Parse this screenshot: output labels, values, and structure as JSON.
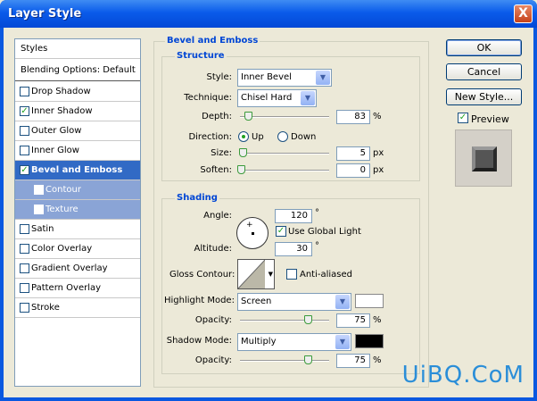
{
  "window": {
    "title": "Layer Style",
    "close_glyph": "X"
  },
  "styles_list": {
    "header": "Styles",
    "blending": "Blending Options: Default",
    "items": [
      {
        "label": "Drop Shadow",
        "checked": false
      },
      {
        "label": "Inner Shadow",
        "checked": true
      },
      {
        "label": "Outer Glow",
        "checked": false
      },
      {
        "label": "Inner Glow",
        "checked": false
      },
      {
        "label": "Bevel and Emboss",
        "checked": true
      },
      {
        "label": "Contour",
        "checked": false
      },
      {
        "label": "Texture",
        "checked": false
      },
      {
        "label": "Satin",
        "checked": false
      },
      {
        "label": "Color Overlay",
        "checked": false
      },
      {
        "label": "Gradient Overlay",
        "checked": false
      },
      {
        "label": "Pattern Overlay",
        "checked": false
      },
      {
        "label": "Stroke",
        "checked": false
      }
    ]
  },
  "bevel": {
    "section_title": "Bevel and Emboss",
    "structure_title": "Structure",
    "style_label": "Style:",
    "style_value": "Inner Bevel",
    "technique_label": "Technique:",
    "technique_value": "Chisel Hard",
    "depth_label": "Depth:",
    "depth_value": "83",
    "depth_unit": "%",
    "direction_label": "Direction:",
    "dir_up": "Up",
    "dir_down": "Down",
    "size_label": "Size:",
    "size_value": "5",
    "size_unit": "px",
    "soften_label": "Soften:",
    "soften_value": "0",
    "soften_unit": "px"
  },
  "shading": {
    "title": "Shading",
    "angle_label": "Angle:",
    "angle_value": "120",
    "angle_unit": "°",
    "global_light": "Use Global Light",
    "altitude_label": "Altitude:",
    "altitude_value": "30",
    "altitude_unit": "°",
    "gloss_label": "Gloss Contour:",
    "anti_aliased": "Anti-aliased",
    "highlight_label": "Highlight Mode:",
    "highlight_value": "Screen",
    "highlight_opacity_label": "Opacity:",
    "highlight_opacity": "75",
    "highlight_unit": "%",
    "shadow_label": "Shadow Mode:",
    "shadow_value": "Multiply",
    "shadow_opacity_label": "Opacity:",
    "shadow_opacity": "75",
    "shadow_unit": "%",
    "highlight_color": "#ffffff",
    "shadow_color": "#000000"
  },
  "buttons": {
    "ok": "OK",
    "cancel": "Cancel",
    "new_style": "New Style...",
    "preview": "Preview"
  },
  "watermark": "UiBQ.CoM"
}
